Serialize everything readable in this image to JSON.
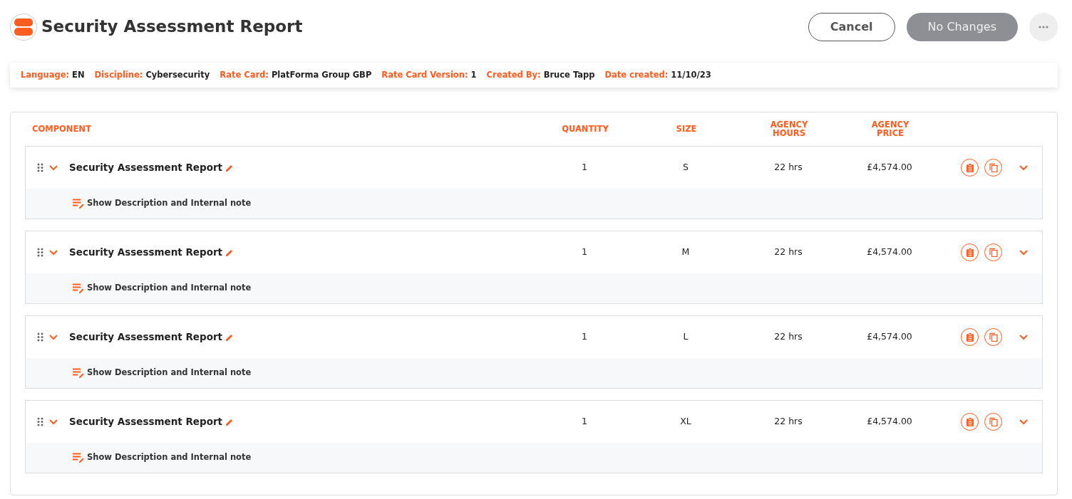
{
  "header": {
    "title": "Security Assessment Report",
    "buttons": [
      {
        "label": "Cancel",
        "kind": "outline"
      },
      {
        "label": "No Changes",
        "kind": "disabled"
      }
    ]
  },
  "meta": [
    {
      "label": "Language:",
      "value": "EN"
    },
    {
      "label": "Discipline:",
      "value": "Cybersecurity"
    },
    {
      "label": "Rate Card:",
      "value": "PlatForma Group GBP"
    },
    {
      "label": "Rate Card Version:",
      "value": "1"
    },
    {
      "label": "Created By:",
      "value": "Bruce Tapp"
    },
    {
      "label": "Date created:",
      "value": "11/10/23"
    }
  ],
  "table": {
    "columns": [
      "COMPONENT",
      "QUANTITY",
      "SIZE",
      "AGENCY HOURS",
      "AGENCY PRICE"
    ],
    "rows": [
      {
        "name": "Security Assessment Report",
        "quantity": "1",
        "size": "S",
        "hours": "22 hrs",
        "price": "£4,574.00",
        "note_link": "Show Description and Internal note"
      },
      {
        "name": "Security Assessment Report",
        "quantity": "1",
        "size": "M",
        "hours": "22 hrs",
        "price": "£4,574.00",
        "note_link": "Show Description and Internal note"
      },
      {
        "name": "Security Assessment Report",
        "quantity": "1",
        "size": "L",
        "hours": "22 hrs",
        "price": "£4,574.00",
        "note_link": "Show Description and Internal note"
      },
      {
        "name": "Security Assessment Report",
        "quantity": "1",
        "size": "XL",
        "hours": "22 hrs",
        "price": "£4,574.00",
        "note_link": "Show Description and Internal note"
      }
    ]
  }
}
